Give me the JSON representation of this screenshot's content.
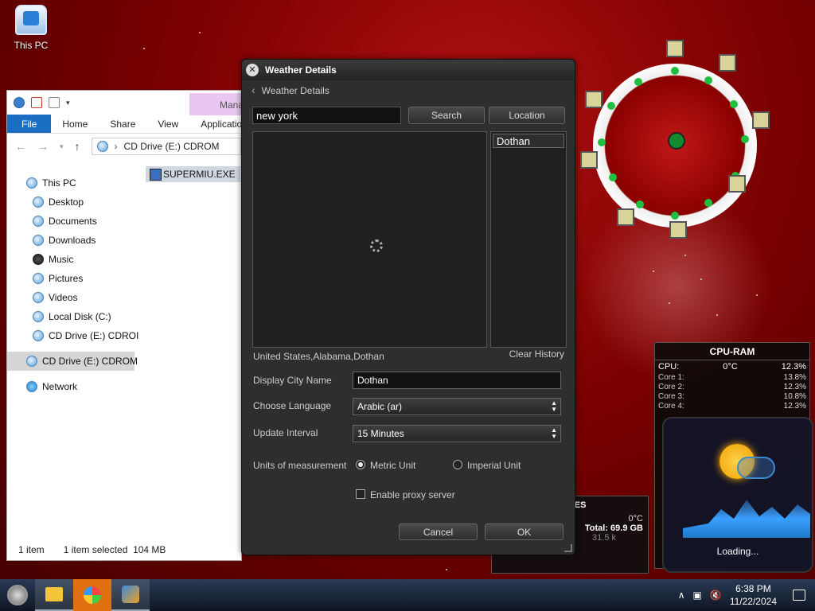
{
  "desktop": {
    "this_pc_label": "This PC"
  },
  "explorer": {
    "manage_tab": "Mana",
    "ribbon_tabs": [
      "File",
      "Home",
      "Share",
      "View",
      "Application"
    ],
    "address": "CD Drive (E:) CDROM",
    "file_name": "SUPERMIU.EXE",
    "tree": [
      "This PC",
      "Desktop",
      "Documents",
      "Downloads",
      "Music",
      "Pictures",
      "Videos",
      "Local Disk (C:)",
      "CD Drive (E:) CDROI",
      "CD Drive (E:) CDROM",
      "Network"
    ],
    "status_items": "1 item",
    "status_selected": "1 item selected  104 MB"
  },
  "weather": {
    "title": "Weather Details",
    "back_label": "Weather Details",
    "search_value": "new york",
    "search_button": "Search",
    "location_button": "Location",
    "history_items": [
      "Dothan"
    ],
    "selected_location": "United States,Alabama,Dothan",
    "clear_history": "Clear History",
    "display_city_label": "Display City Name",
    "display_city_value": "Dothan",
    "language_label": "Choose Language",
    "language_value": "Arabic (ar)",
    "interval_label": "Update Interval",
    "interval_value": "15 Minutes",
    "units_label": "Units of measurement",
    "metric_label": "Metric Unit",
    "imperial_label": "Imperial Unit",
    "units_selected": "metric",
    "proxy_label": "Enable proxy server",
    "proxy_checked": false,
    "cancel_button": "Cancel",
    "ok_button": "OK"
  },
  "cpu_gadget": {
    "title": "CPU-RAM",
    "cpu_label": "CPU:",
    "cpu_temp": "0°C",
    "cpu_value": "12.3%",
    "cores": [
      {
        "name": "Core 1:",
        "value": "13.8%"
      },
      {
        "name": "Core 2:",
        "value": "12.3%"
      },
      {
        "name": "Core 3:",
        "value": "10.8%"
      },
      {
        "name": "Core 4:",
        "value": "12.3%"
      }
    ]
  },
  "weather_widget": {
    "loading": "Loading..."
  },
  "drives_gadget": {
    "title": "DRIVES",
    "temp": "0°C",
    "total": "Total: 69.9 GB",
    "sub": "31.5 k"
  },
  "taskbar": {
    "time": "6:38 PM",
    "date": "11/22/2024"
  },
  "colors": {
    "accent": "#1a6fc4",
    "dialog_bg": "#2e2e2e",
    "desktop_red": "#7a0000"
  }
}
